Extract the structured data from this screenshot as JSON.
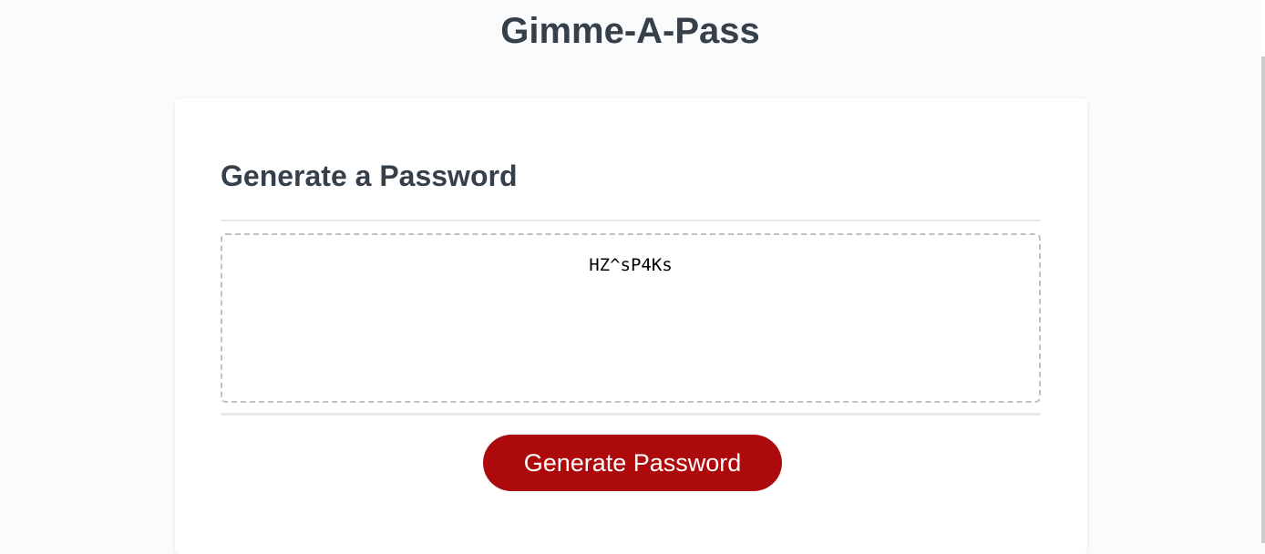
{
  "header": {
    "title": "Gimme-A-Pass"
  },
  "card": {
    "title": "Generate a Password",
    "password_value": "HZ^sP4Ks",
    "generate_label": "Generate Password"
  },
  "colors": {
    "accent": "#ad0a0c",
    "text": "#36404a",
    "background": "#f9fbfd"
  }
}
